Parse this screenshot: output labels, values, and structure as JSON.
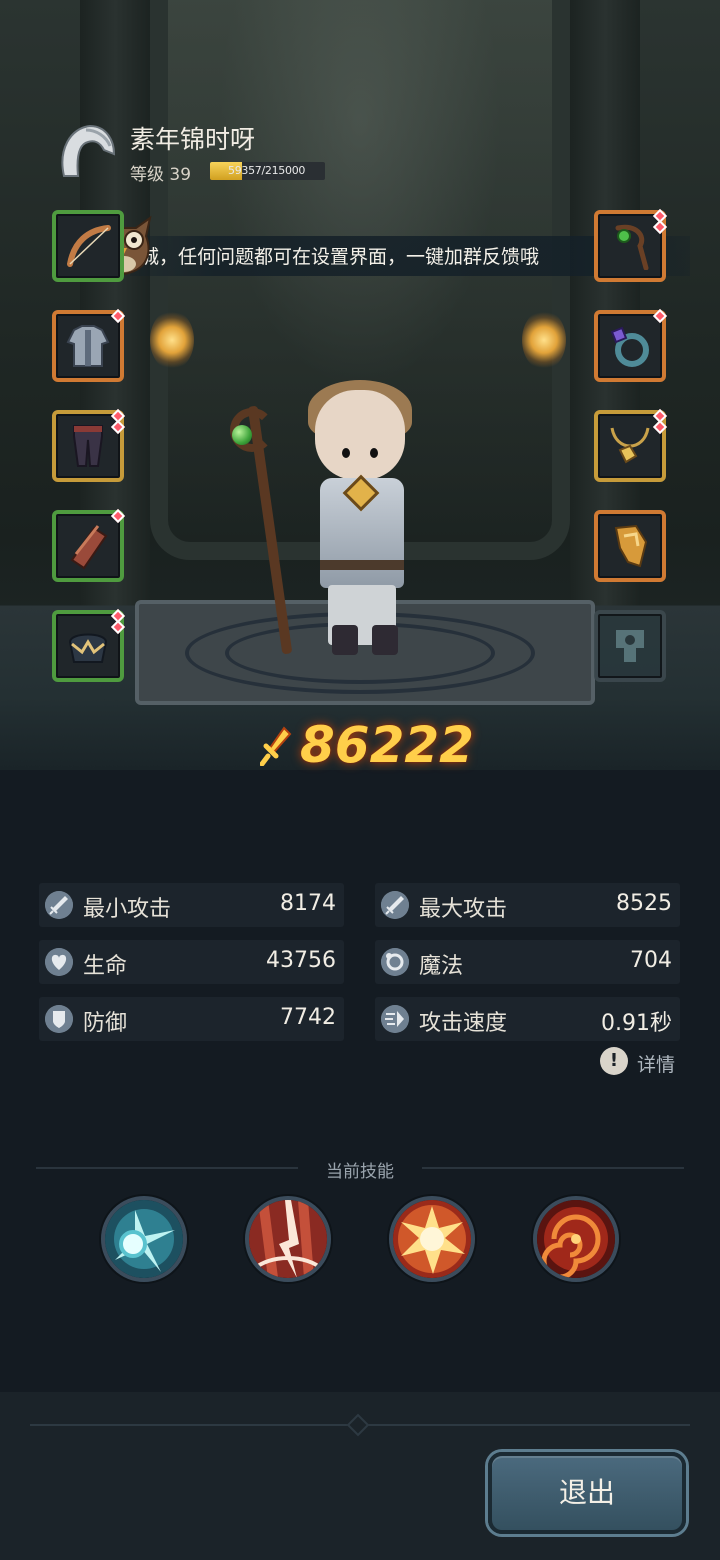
{
  "player": {
    "name": "素年锦时呀",
    "level_label": "等级 39",
    "exp_text": "59357/215000",
    "exp_current": 59357,
    "exp_max": 215000,
    "avatar_icon": "helmet-icon"
  },
  "notice": {
    "text": "城，任何问题都可在设置界面，一键加群反馈哦",
    "mascot_icon": "owl-icon"
  },
  "equipment": {
    "left": [
      {
        "icon": "bow-icon",
        "rarity": "green"
      },
      {
        "icon": "armor-icon",
        "rarity": "orange"
      },
      {
        "icon": "pants-icon",
        "rarity": "gold"
      },
      {
        "icon": "bracer-icon",
        "rarity": "green"
      },
      {
        "icon": "helmet-crown-icon",
        "rarity": "green"
      }
    ],
    "right": [
      {
        "icon": "staff-icon",
        "rarity": "orange"
      },
      {
        "icon": "ring-icon",
        "rarity": "orange"
      },
      {
        "icon": "necklace-icon",
        "rarity": "gold"
      },
      {
        "icon": "gauntlet-icon",
        "rarity": "orange"
      },
      {
        "icon": "skin-icon",
        "rarity": "dim"
      }
    ]
  },
  "power": {
    "value": "86222",
    "icon": "sword-power-icon"
  },
  "stats": [
    {
      "icon": "sword-icon",
      "name": "最小攻击",
      "value": "8174"
    },
    {
      "icon": "sword-icon",
      "name": "最大攻击",
      "value": "8525"
    },
    {
      "icon": "heart-icon",
      "name": "生命",
      "value": "43756"
    },
    {
      "icon": "magic-icon",
      "name": "魔法",
      "value": "704"
    },
    {
      "icon": "shield-icon",
      "name": "防御",
      "value": "7742"
    },
    {
      "icon": "speed-icon",
      "name": "攻击速度",
      "value": "0.91秒"
    }
  ],
  "detail_label": "详情",
  "skills": {
    "title": "当前技能",
    "items": [
      {
        "icon": "ice-burst-skill-icon"
      },
      {
        "icon": "lightning-skill-icon"
      },
      {
        "icon": "explosion-skill-icon"
      },
      {
        "icon": "fire-vortex-skill-icon"
      }
    ]
  },
  "footer": {
    "exit_label": "退出"
  },
  "colors": {
    "power": "#ffcf4a",
    "exp_fill": "#f7d35a",
    "rarity_green": "#4f9b3f",
    "rarity_orange": "#d07a33",
    "rarity_gold": "#c69b3a",
    "background": "#141b22"
  }
}
